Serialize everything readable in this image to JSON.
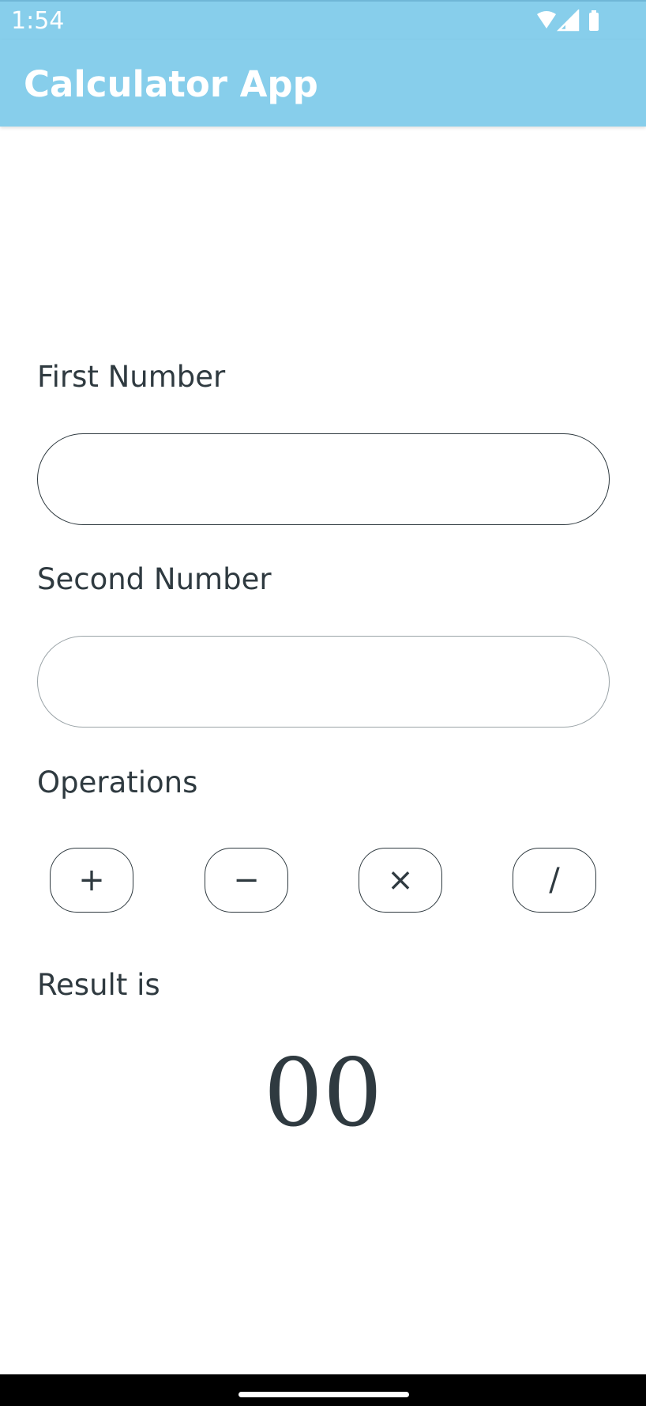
{
  "status_bar": {
    "time": "1:54",
    "icons": [
      "wifi-icon",
      "cell-signal-icon",
      "battery-icon"
    ]
  },
  "app_bar": {
    "title": "Calculator App",
    "color": "#87ceeb"
  },
  "form": {
    "first_label": "First Number",
    "first_value": "",
    "second_label": "Second Number",
    "second_value": "",
    "operations_label": "Operations",
    "operations": [
      {
        "name": "add-button",
        "icon": "plus-icon",
        "glyph": "+"
      },
      {
        "name": "subtract-button",
        "icon": "minus-icon",
        "glyph": "−"
      },
      {
        "name": "multiply-button",
        "icon": "multiply-icon",
        "glyph": "×"
      },
      {
        "name": "divide-button",
        "icon": "divide-icon",
        "glyph": "/"
      }
    ]
  },
  "result": {
    "label": "Result is",
    "value": "00"
  }
}
